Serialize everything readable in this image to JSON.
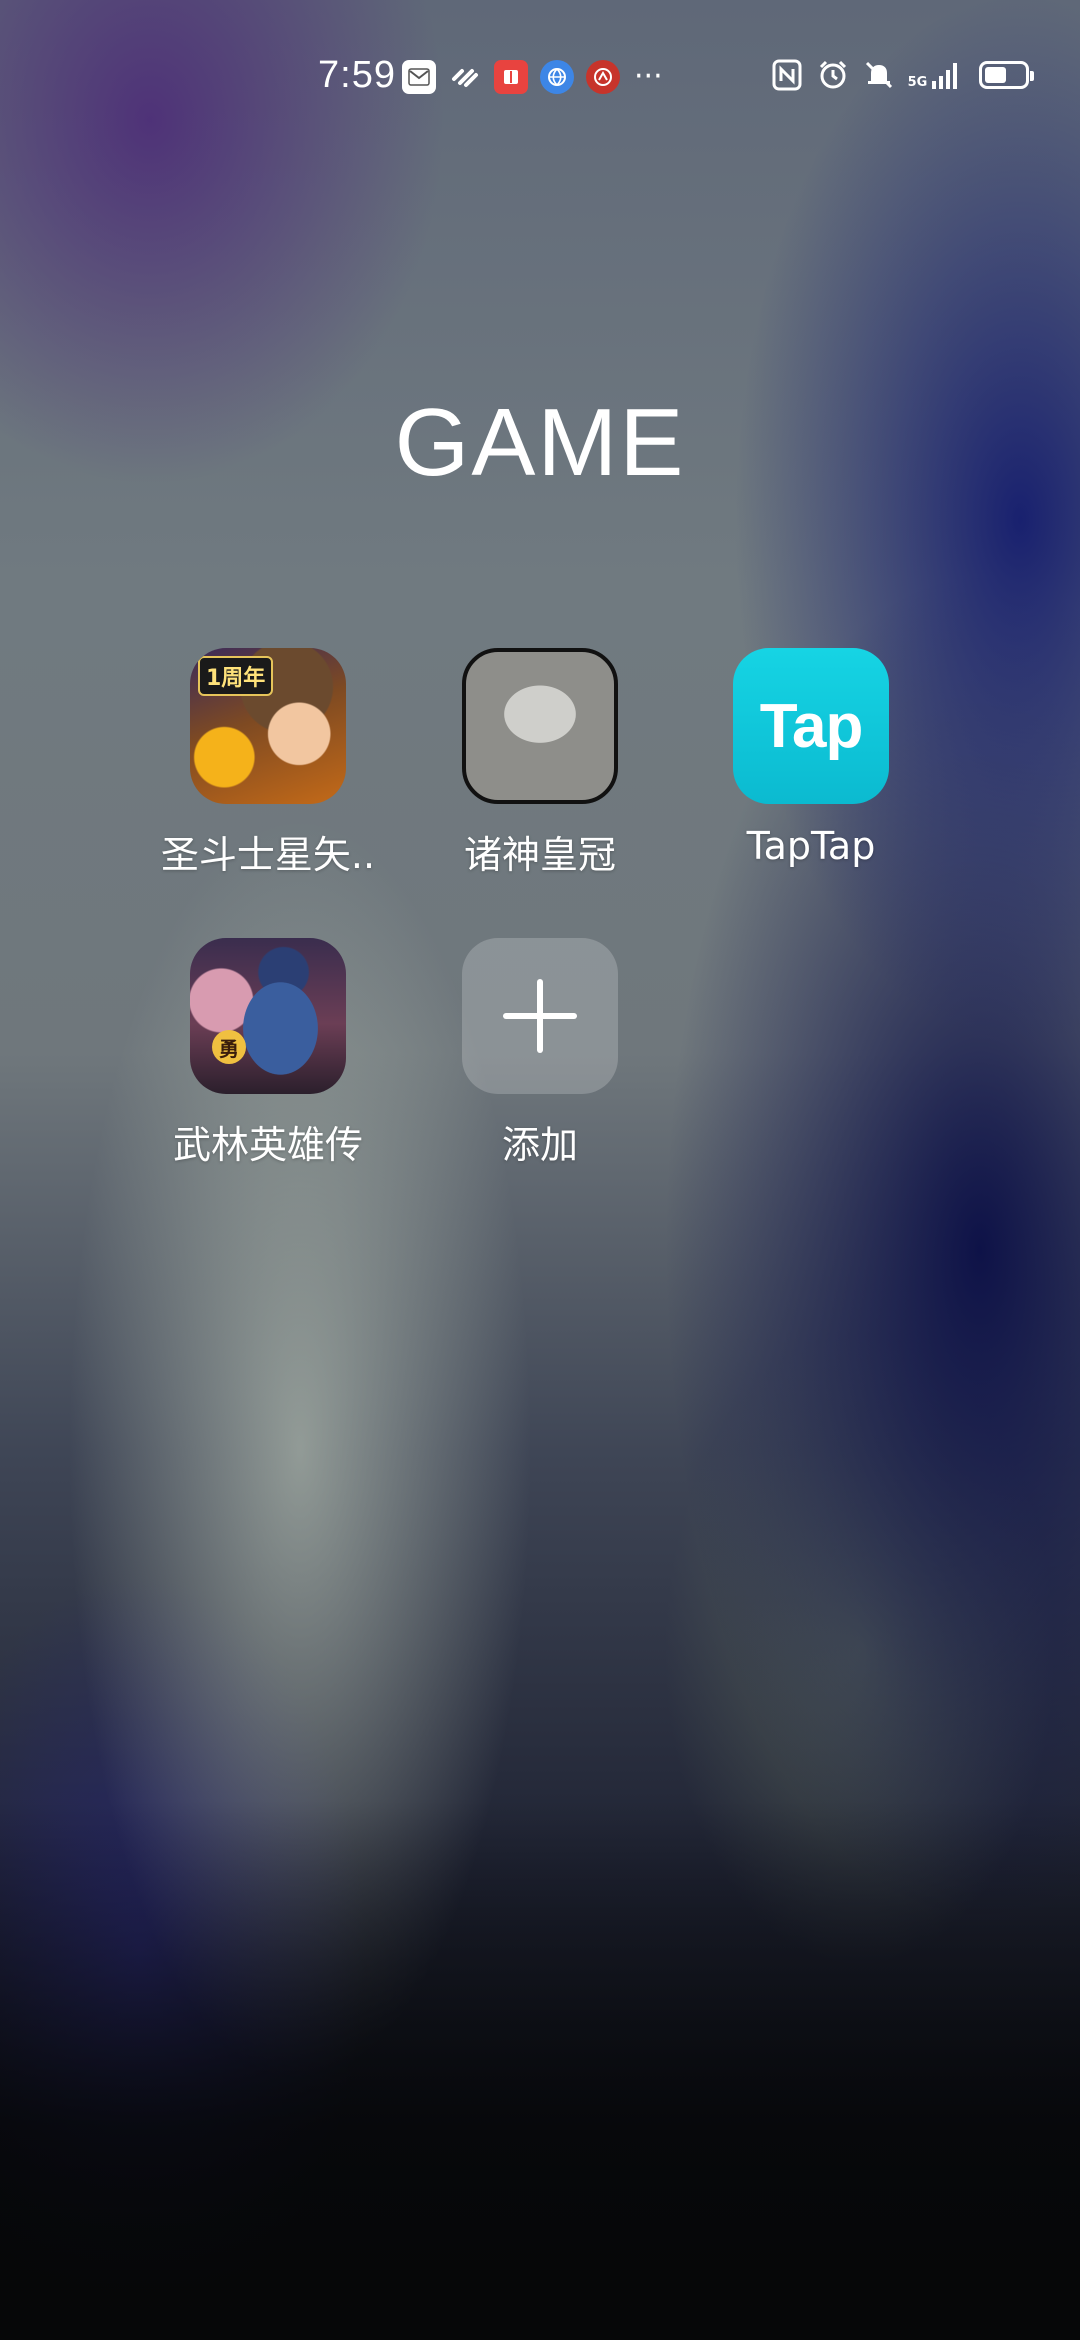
{
  "status_bar": {
    "time": "7:59",
    "notification_icons": [
      "message-icon",
      "link-icon",
      "book-app-icon",
      "browser-app-icon",
      "bank-app-icon"
    ],
    "more": "···",
    "system_icons": [
      "nfc-icon",
      "alarm-icon",
      "mute-icon",
      "signal-icon",
      "battery-icon"
    ],
    "network_label": "5G",
    "battery_level": 0.55
  },
  "folder": {
    "title": "GAME",
    "apps": [
      {
        "label": "圣斗士星矢..",
        "icon": "saint-seiya-icon",
        "badge": "1周年"
      },
      {
        "label": "诸神皇冠",
        "icon": "crown-of-gods-icon"
      },
      {
        "label": "TapTap",
        "icon": "taptap-icon",
        "icon_text": "Tap"
      },
      {
        "label": "武林英雄传",
        "icon": "wulin-heroes-icon",
        "icon_text": "勇"
      },
      {
        "label": "添加",
        "icon": "add-icon"
      }
    ]
  },
  "colors": {
    "taptap_brand": "#13cadd",
    "add_tile": "rgba(255,255,255,0.2)"
  }
}
